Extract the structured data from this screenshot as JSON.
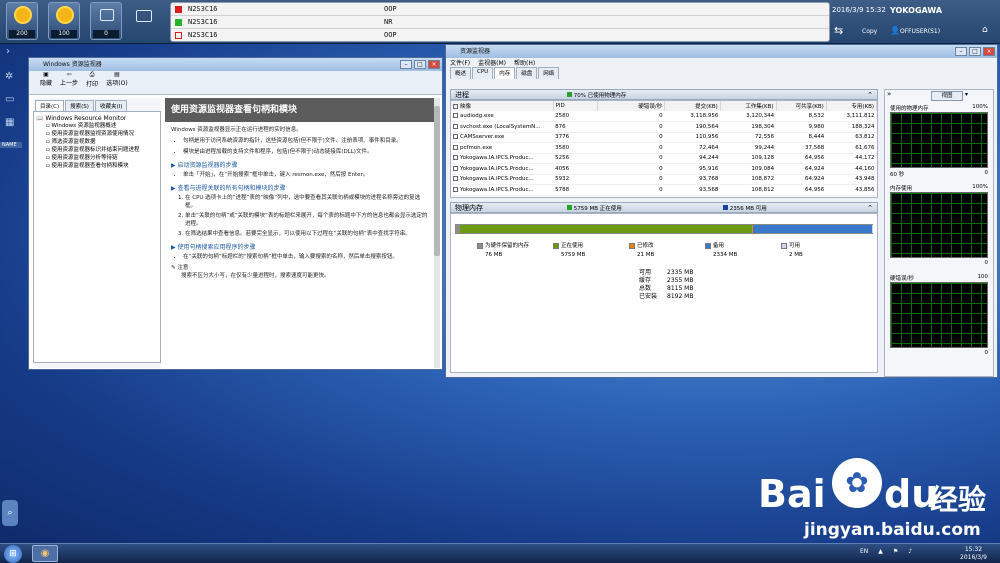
{
  "top_bar": {
    "icons": [
      {
        "value": "200"
      },
      {
        "value": "100"
      },
      {
        "value": "0"
      }
    ],
    "alarms": [
      {
        "tag": "N2S3C16",
        "state": "OOP",
        "color": "#d81e1e"
      },
      {
        "tag": "N2S3C16",
        "state": "NR",
        "color": "#28b428"
      },
      {
        "tag": "N2S3C16",
        "state": "OOP",
        "color": "#d81e1e"
      }
    ],
    "datetime": "2016/3/9 15:32",
    "brand": "YOKOGAWA",
    "copy_label": "Copy",
    "user": "OFFUSER(S1)"
  },
  "help_window": {
    "title": "Windows 资源监视器",
    "toolbar": [
      "隐藏",
      "上一步",
      "打印",
      "选项(O)"
    ],
    "tabs": [
      "目录(C)",
      "搜索(S)",
      "收藏夹(I)"
    ],
    "tree_root": "Windows Resource Monitor",
    "tree_items": [
      "Windows 资源监视器概述",
      "使用资源监视器监视资源使用情况",
      "筛选资源监视数据",
      "使用资源监视器标识并结束问题进程",
      "使用资源监视器分析等待链",
      "使用资源监视器查看句柄和模块"
    ],
    "heading": "使用资源监视器查看句柄和模块",
    "p1": "Windows 资源监视器显示正在运行进程的实时信息。",
    "b1": "句柄是用于访问系统资源的指针，这些资源包括(但不限于)文件、注册表项、事件和目录。",
    "b2": "模块是由进程加载的支持文件和程序，包括(但不限于)动态链接库(DLL)文件。",
    "s1": "启动资源监视器的步骤",
    "s1a": "单击「开始」，在“开始搜索”框中单击，键入 resmon.exe，然后按 Enter。",
    "s2": "查看与进程关联的所有句柄和模块的步骤",
    "s2a": "在 CPU 选项卡上的“进程”表的“映像”列中，选中要查看其关联句柄或模块的进程名称旁边的复选框。",
    "s2b": "单击“关联的句柄”或“关联的模块”表的标题栏来展开，每个表的标题中下方的信息也都会显示选定的进程。",
    "s2c": "在筛选结果中查看信息。若要完全显示，可以使用以下过程在“关联的句柄”表中查找字符串。",
    "s3": "使用句柄搜索应用程序的步骤",
    "s3a": "在“关联的句柄”标题栏的“搜索句柄”框中单击，输入要搜索的名称，然后单击搜索按钮。",
    "note_label": "注意",
    "note_text": "搜索不区分大小写，在仅有少量进程时，搜索速度可能更快。"
  },
  "rm_window": {
    "title": "资源监视器",
    "menu": [
      "文件(F)",
      "监视器(M)",
      "帮助(H)"
    ],
    "tabs": [
      "概述",
      "CPU",
      "内存",
      "磁盘",
      "网络"
    ],
    "proc_section": "进程",
    "proc_badge": "70% 已使用物理内存",
    "cols": [
      "映像",
      "PID",
      "硬错误/秒",
      "提交(KB)",
      "工作集(KB)",
      "可共享(KB)",
      "专用(KB)"
    ],
    "rows": [
      [
        "audiodg.exe",
        "2580",
        "0",
        "3,118,956",
        "3,120,344",
        "8,532",
        "3,111,812"
      ],
      [
        "svchost.exe (LocalSystemN...",
        "876",
        "0",
        "190,564",
        "198,304",
        "9,980",
        "188,324"
      ],
      [
        "CAMSserver.exe",
        "3776",
        "0",
        "110,956",
        "72,556",
        "8,444",
        "63,812"
      ],
      [
        "pcfmon.exe",
        "3580",
        "0",
        "72,464",
        "99,244",
        "37,568",
        "61,676"
      ],
      [
        "Yokogawa.IA.iPCS.Produc...",
        "5256",
        "0",
        "94,244",
        "109,128",
        "64,956",
        "44,172"
      ],
      [
        "Yokogawa.IA.iPCS.Produc...",
        "4056",
        "0",
        "95,916",
        "109,084",
        "64,924",
        "44,160"
      ],
      [
        "Yokogawa.IA.iPCS.Produc...",
        "5932",
        "0",
        "93,768",
        "108,872",
        "64,924",
        "43,948"
      ],
      [
        "Yokogawa.IA.iPCS.Produc...",
        "5788",
        "0",
        "93,568",
        "108,812",
        "64,956",
        "43,856"
      ]
    ],
    "mem_section": "物理内存",
    "mem_use": "5759 MB 正在使用",
    "mem_avail": "2356 MB 可用",
    "legend": [
      {
        "label": "为硬件保留的内存",
        "value": "76 MB",
        "color": "#8d8d8d"
      },
      {
        "label": "正在使用",
        "value": "5759 MB",
        "color": "#6a9b12"
      },
      {
        "label": "已修改",
        "value": "21 MB",
        "color": "#e4830e"
      },
      {
        "label": "备用",
        "value": "2334 MB",
        "color": "#3a78c9"
      },
      {
        "label": "可用",
        "value": "2 MB",
        "color": "#c9d8ec"
      }
    ],
    "stats": [
      {
        "k": "可用",
        "v": "2335 MB"
      },
      {
        "k": "缓存",
        "v": "2355 MB"
      },
      {
        "k": "总数",
        "v": "8115 MB"
      },
      {
        "k": "已安装",
        "v": "8192 MB"
      }
    ],
    "view_button": "视图",
    "graphs": [
      {
        "title": "使用的物理内存",
        "max": "100%",
        "left": "60 秒",
        "right": "0"
      },
      {
        "title": "内存使用",
        "max": "100%",
        "left": "",
        "right": "0"
      },
      {
        "title": "硬错误/秒",
        "max": "100",
        "left": "",
        "right": "0"
      }
    ]
  },
  "watermark": {
    "brand_a": "Bai",
    "brand_b": "du",
    "brand_c": "经验",
    "url": "jingyan.baidu.com"
  },
  "taskbar": {
    "lang": "EN",
    "time": "15:32",
    "date": "2016/3/9"
  }
}
